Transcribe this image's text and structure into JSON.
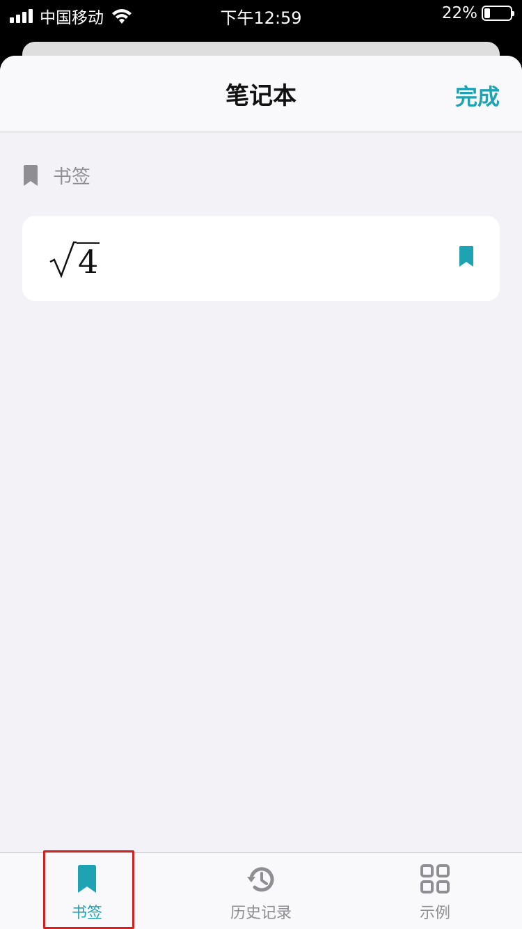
{
  "status_bar": {
    "carrier": "中国移动",
    "time": "下午12:59",
    "battery": "22%",
    "battery_level": 0.22
  },
  "sheet": {
    "title": "笔记本",
    "done_label": "完成"
  },
  "section": {
    "label": "书签",
    "icon": "bookmark-icon"
  },
  "bookmarks": [
    {
      "radicand": "4",
      "expression": "√4",
      "bookmarked": true
    }
  ],
  "tabs": [
    {
      "label": "书签",
      "icon": "bookmark-icon",
      "selected": true
    },
    {
      "label": "历史记录",
      "icon": "history-icon",
      "selected": false
    },
    {
      "label": "示例",
      "icon": "grid-icon",
      "selected": false
    }
  ],
  "colors": {
    "accent": "#1fa3b3",
    "secondary": "#8e8e93",
    "background": "#f2f2f7",
    "highlight": "#d32020"
  }
}
